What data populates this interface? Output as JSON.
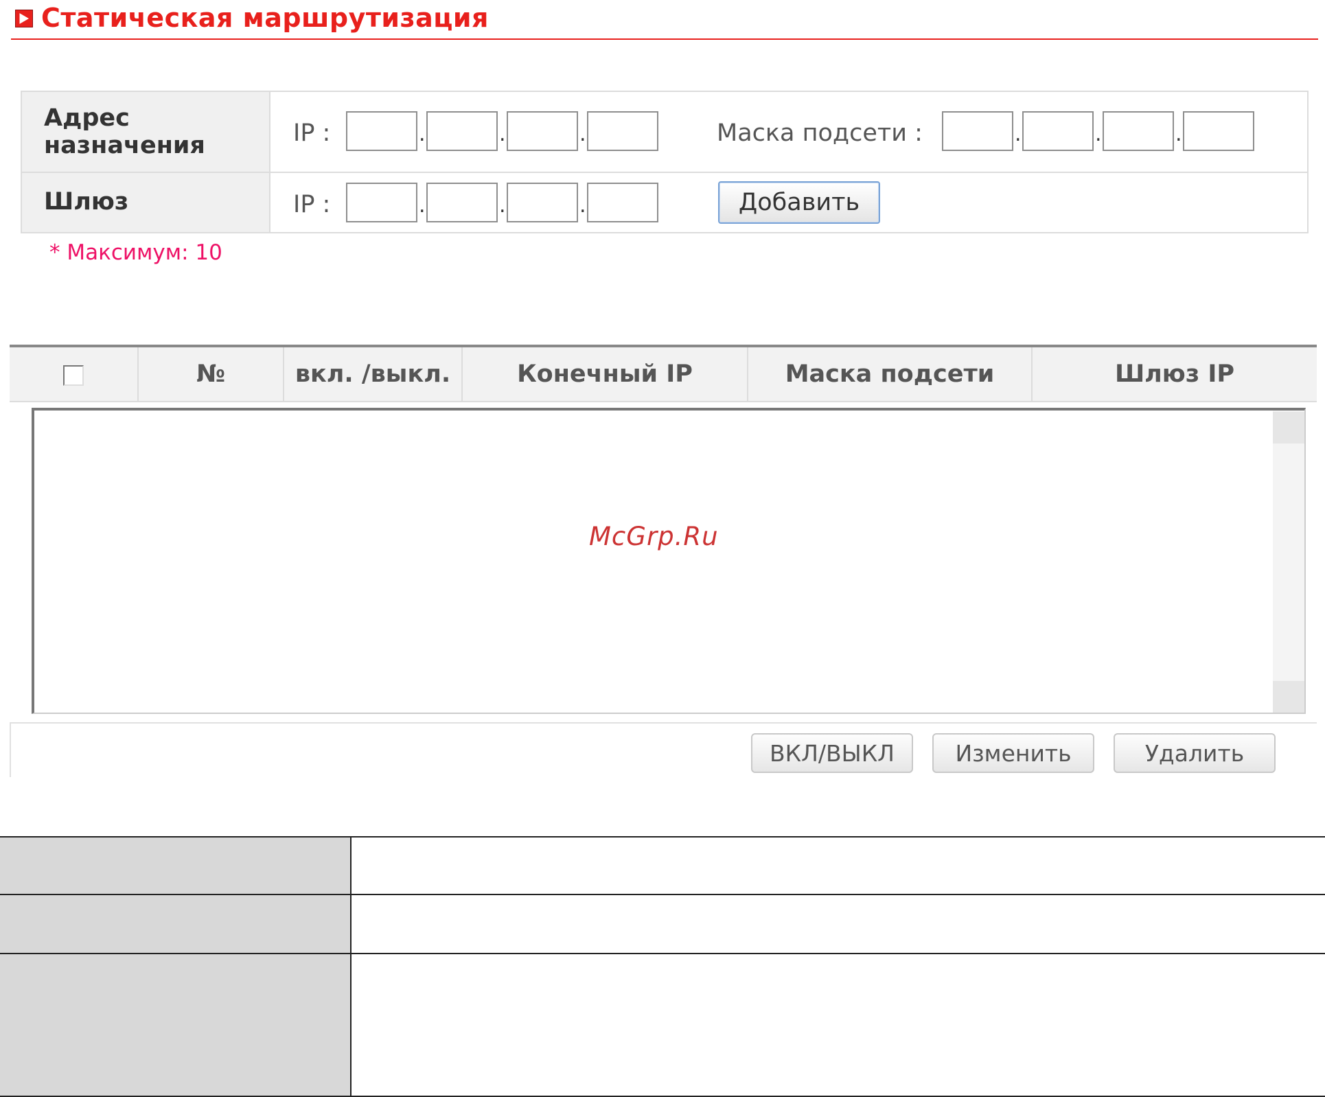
{
  "header": {
    "title": "Статическая маршрутизация",
    "icon": "red-arrow-icon",
    "accent": "#e8201c"
  },
  "form": {
    "destination_label": "Адрес назначения",
    "destination_label_line1": "Адрес",
    "destination_label_line2": "назначения",
    "ip_label": "IP :",
    "subnet_label": "Маска подсети :",
    "gateway_label": "Шлюз",
    "dot": ".",
    "add_button": "Добавить",
    "note": "* Максимум: 10"
  },
  "list": {
    "columns": [
      "№",
      "вкл. /выкл.",
      "Конечный IP",
      "Маска подсети",
      "Шлюз IP"
    ],
    "rows": [],
    "buttons": {
      "toggle": "ВКЛ/ВЫКЛ",
      "edit": "Изменить",
      "delete": "Удалить"
    }
  },
  "watermark": "McGrp.Ru"
}
